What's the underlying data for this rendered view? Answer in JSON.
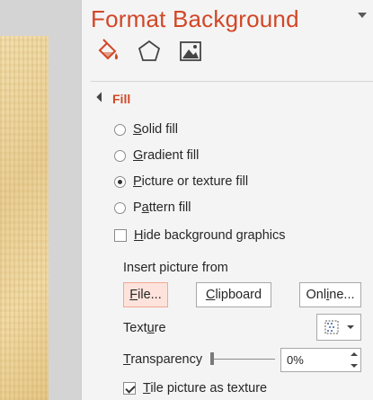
{
  "pane": {
    "title": "Format Background"
  },
  "tabs": [
    {
      "name": "fill-line-icon",
      "active": true
    },
    {
      "name": "effects-icon",
      "active": false
    },
    {
      "name": "picture-icon",
      "active": false
    }
  ],
  "fill_section": {
    "label": "Fill",
    "options": [
      {
        "label": "Solid fill",
        "access_key": "S",
        "rest": "olid fill",
        "checked": false
      },
      {
        "label": "Gradient fill",
        "access_key": "G",
        "rest": "radient fill",
        "checked": false
      },
      {
        "label": "Picture or texture fill",
        "access_key": "P",
        "rest": "icture or texture fill",
        "checked": true
      },
      {
        "label": "Pattern fill",
        "pre": "P",
        "access_key": "a",
        "rest": "ttern fill",
        "checked": false
      }
    ],
    "hide_graphics": {
      "pre": "",
      "access_key": "H",
      "rest": "ide background graphics",
      "checked": false
    }
  },
  "insert_picture": {
    "label": "Insert picture from",
    "file_button": {
      "pre": "",
      "access_key": "F",
      "rest": "ile..."
    },
    "clipboard_button": {
      "pre": "",
      "access_key": "C",
      "rest": "lipboard"
    },
    "online_button": {
      "pre": "Onl",
      "access_key": "i",
      "rest": "ne..."
    }
  },
  "texture": {
    "pre": "Text",
    "access_key": "u",
    "rest": "re"
  },
  "transparency": {
    "pre": "",
    "access_key": "T",
    "rest": "ransparency",
    "value": "0%",
    "level": 0
  },
  "tile": {
    "pre": "",
    "access_key": "T",
    "rest": "ile picture as texture",
    "checked": true
  },
  "colors": {
    "accent": "#d24726",
    "hot_button": "#fde3db"
  }
}
